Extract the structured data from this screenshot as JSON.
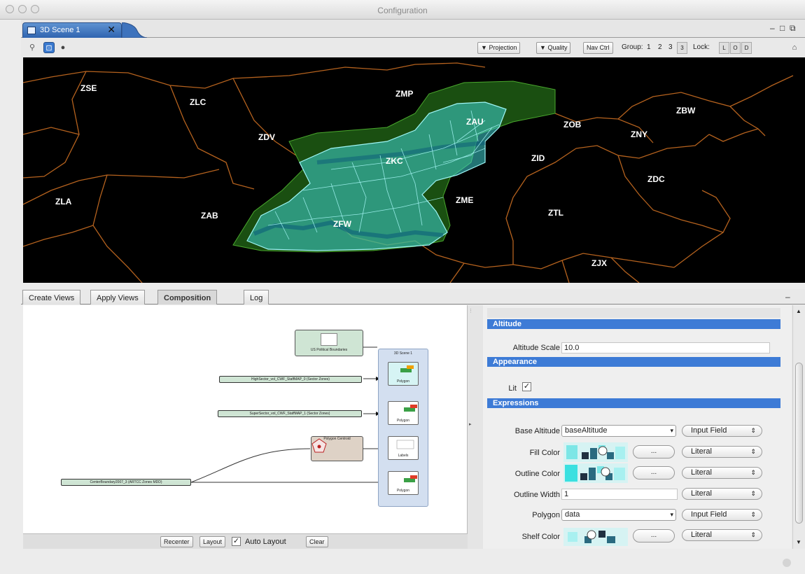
{
  "window": {
    "title": "Configuration"
  },
  "editor_tab": {
    "label": "3D Scene 1",
    "close": "✕"
  },
  "toolbar": {
    "projection_label": "Projection",
    "quality_label": "Quality",
    "navctrl_label": "Nav Ctrl",
    "group_label": "Group:",
    "group_values": [
      "1",
      "2",
      "3",
      "3"
    ],
    "lock_label": "Lock:",
    "lock_values": [
      "L",
      "O",
      "D"
    ],
    "home_icon": "home-icon",
    "dropdown_marker": "▼"
  },
  "map": {
    "regions": [
      "ZSE",
      "ZLC",
      "ZMP",
      "ZAU",
      "ZOB",
      "ZBW",
      "ZNY",
      "ZDV",
      "ZKC",
      "ZID",
      "ZDC",
      "ZLA",
      "ZAB",
      "ZFW",
      "ZME",
      "ZTL",
      "ZJX"
    ],
    "colors": {
      "boundary": "#c06a2a",
      "volume_fill": "#3fd4d4",
      "volume_edge": "#9ff6f6",
      "outer_volume": "#2f8f1f"
    }
  },
  "bottom_tabs": [
    "Create Views",
    "Apply Views",
    "Composition",
    "Log"
  ],
  "active_tab": "Composition",
  "composition": {
    "nodes": {
      "political": "US Political Boundaries",
      "scene": "3D Scene 1",
      "high": "HighSector_vol_CWF_StaffMAP_0 (Sector Zones)",
      "super": "SuperSector_vol_CWF_StaffMAP_1 (Sector Zones)",
      "centroid": "Polygon Centroid",
      "center": "CenterBoundary2007_3 (ARTCC Zones MDD)",
      "polygon": "Polygon",
      "labels": "Labels"
    },
    "buttons": {
      "recenter": "Recenter",
      "layout": "Layout",
      "auto_layout": "Auto Layout",
      "clear": "Clear"
    },
    "auto_layout_checked": true
  },
  "properties": {
    "sections": {
      "altitude": "Altitude",
      "appearance": "Appearance",
      "expressions": "Expressions"
    },
    "altitude_scale": {
      "label": "Altitude Scale",
      "value": "10.0"
    },
    "lit": {
      "label": "Lit",
      "checked": true
    },
    "expressions": {
      "base_altitude": {
        "label": "Base Altitude",
        "value": "baseAltitude",
        "mode": "Input Field"
      },
      "fill_color": {
        "label": "Fill Color",
        "mode": "Literal"
      },
      "outline_color": {
        "label": "Outline Color",
        "mode": "Literal"
      },
      "outline_width": {
        "label": "Outline Width",
        "value": "1",
        "mode": "Literal"
      },
      "polygon": {
        "label": "Polygon",
        "value": "data",
        "mode": "Input Field"
      },
      "shelf_color": {
        "label": "Shelf Color",
        "mode": "Literal"
      }
    },
    "ellipsis": "...",
    "arrow": "▾",
    "updown": "⇕"
  }
}
